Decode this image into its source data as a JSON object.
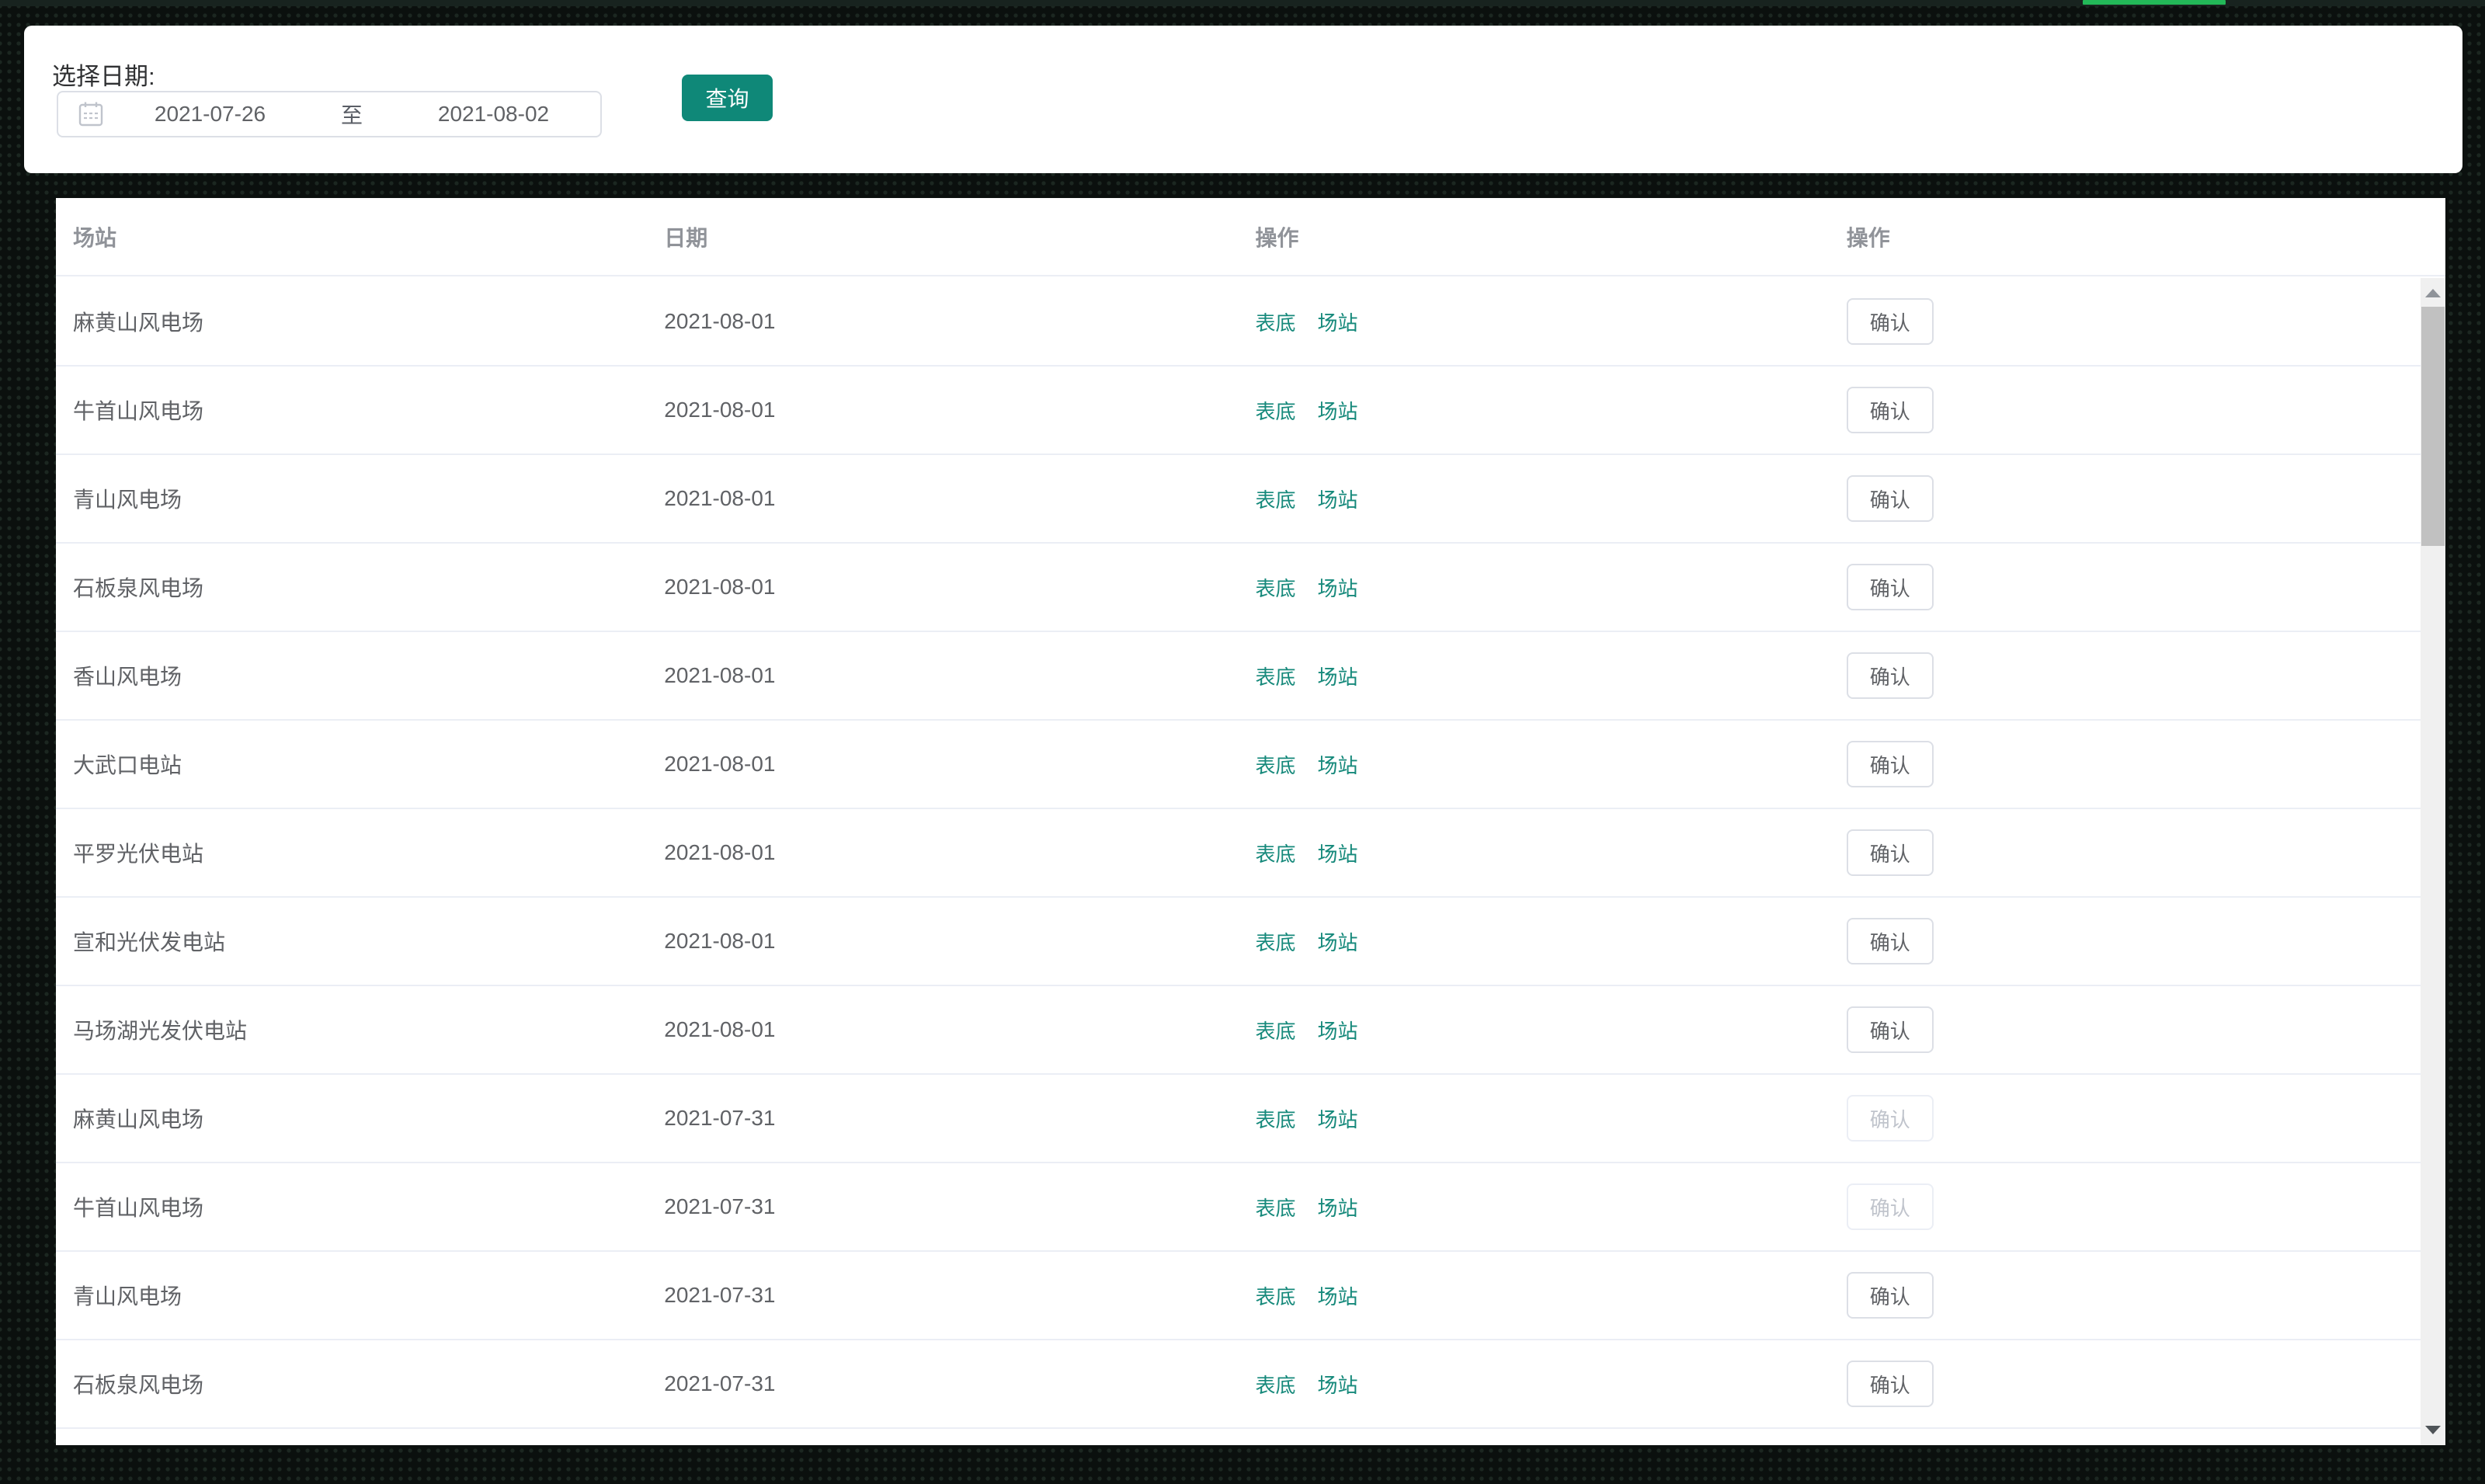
{
  "theme": {
    "accent_teal": "#0f8878",
    "link_teal": "#16897b",
    "loading_green": "#23b858",
    "page_bg": "#0b100e",
    "dot_color": "#1c2721",
    "header_text": "#909399",
    "body_text": "#606266",
    "divider": "#ebeef5",
    "disabled_text": "#c0c4cc",
    "disabled_border": "#ebeef5",
    "scroll_track": "#f0f0f0",
    "scroll_thumb": "#c1c1c1"
  },
  "filter": {
    "label": "选择日期:",
    "start_date": "2021-07-26",
    "separator": "至",
    "end_date": "2021-08-02",
    "query_button": "查询",
    "calendar_icon": "calendar-icon"
  },
  "table": {
    "columns": [
      "场站",
      "日期",
      "操作",
      "操作"
    ],
    "link_labels": [
      "表底",
      "场站"
    ],
    "confirm_label": "确认",
    "rows": [
      {
        "station": "麻黄山风电场",
        "date": "2021-08-01",
        "confirm_enabled": true
      },
      {
        "station": "牛首山风电场",
        "date": "2021-08-01",
        "confirm_enabled": true
      },
      {
        "station": "青山风电场",
        "date": "2021-08-01",
        "confirm_enabled": true
      },
      {
        "station": "石板泉风电场",
        "date": "2021-08-01",
        "confirm_enabled": true
      },
      {
        "station": "香山风电场",
        "date": "2021-08-01",
        "confirm_enabled": true
      },
      {
        "station": "大武口电站",
        "date": "2021-08-01",
        "confirm_enabled": true
      },
      {
        "station": "平罗光伏电站",
        "date": "2021-08-01",
        "confirm_enabled": true
      },
      {
        "station": "宣和光伏发电站",
        "date": "2021-08-01",
        "confirm_enabled": true
      },
      {
        "station": "马场湖光发伏电站",
        "date": "2021-08-01",
        "confirm_enabled": true
      },
      {
        "station": "麻黄山风电场",
        "date": "2021-07-31",
        "confirm_enabled": false
      },
      {
        "station": "牛首山风电场",
        "date": "2021-07-31",
        "confirm_enabled": false
      },
      {
        "station": "青山风电场",
        "date": "2021-07-31",
        "confirm_enabled": true
      },
      {
        "station": "石板泉风电场",
        "date": "2021-07-31",
        "confirm_enabled": true
      }
    ]
  }
}
